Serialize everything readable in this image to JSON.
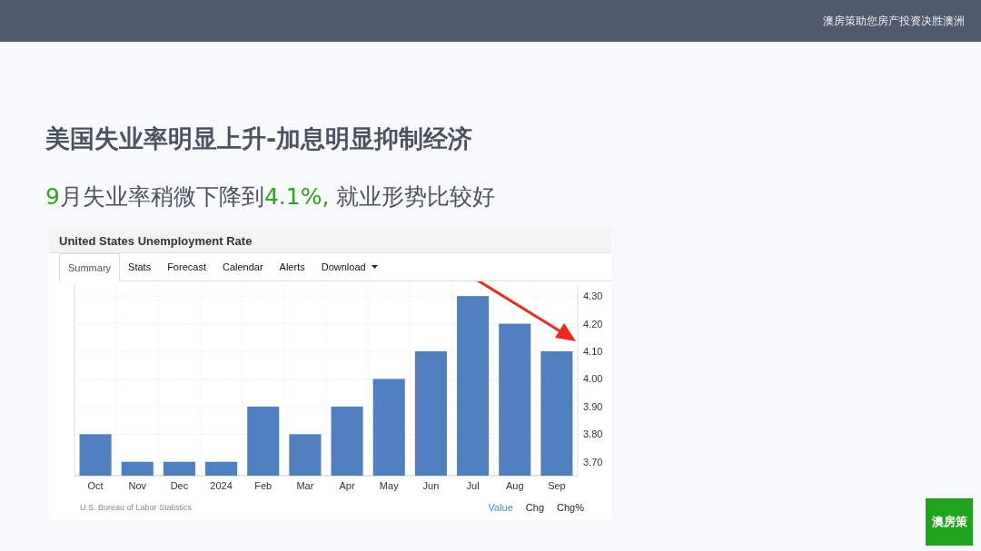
{
  "header": {
    "tagline": "澳房策助您房产投资决胜澳洲"
  },
  "slide": {
    "title": "美国失业率明显上升-加息明显抑制经济",
    "subtitle": [
      {
        "text": "9",
        "highlight": true
      },
      {
        "text": "月失业率稍微下降到",
        "highlight": false
      },
      {
        "text": "4.1%,",
        "highlight": true
      },
      {
        "text": " 就业形势比较好",
        "highlight": false
      }
    ]
  },
  "widget": {
    "title": "United States Unemployment Rate",
    "tabs": [
      {
        "label": "Summary",
        "selected": true,
        "dropdown": false
      },
      {
        "label": "Stats",
        "selected": false,
        "dropdown": false
      },
      {
        "label": "Forecast",
        "selected": false,
        "dropdown": false
      },
      {
        "label": "Calendar",
        "selected": false,
        "dropdown": false
      },
      {
        "label": "Alerts",
        "selected": false,
        "dropdown": false
      },
      {
        "label": "Download",
        "selected": false,
        "dropdown": true
      }
    ],
    "chart_data": {
      "type": "bar",
      "categories": [
        "Oct",
        "Nov",
        "Dec",
        "2024",
        "Feb",
        "Mar",
        "Apr",
        "May",
        "Jun",
        "Jul",
        "Aug",
        "Sep"
      ],
      "grid": true,
      "series": [
        {
          "color": "#4f7fbe",
          "values": [
            3.8,
            3.7,
            3.7,
            3.7,
            3.9,
            3.8,
            3.9,
            4.0,
            4.1,
            4.3,
            4.2,
            4.1
          ]
        }
      ],
      "ylim": [
        3.65,
        4.34
      ],
      "yticks": [
        {
          "value": 3.7,
          "label": "3.70"
        },
        {
          "value": 3.8,
          "label": "3.80"
        },
        {
          "value": 3.9,
          "label": "3.90"
        },
        {
          "value": 4.0,
          "label": "4.00"
        },
        {
          "value": 4.1,
          "label": "4.10"
        },
        {
          "value": 4.2,
          "label": "4.20"
        },
        {
          "value": 4.3,
          "label": "4.30"
        }
      ]
    },
    "source": "U.S. Bureau of Labor Statistics",
    "views": [
      {
        "label": "Value",
        "selected": true
      },
      {
        "label": "Chg",
        "selected": false
      },
      {
        "label": "Chg%",
        "selected": false
      }
    ]
  },
  "logo": {
    "text": "澳房策"
  }
}
